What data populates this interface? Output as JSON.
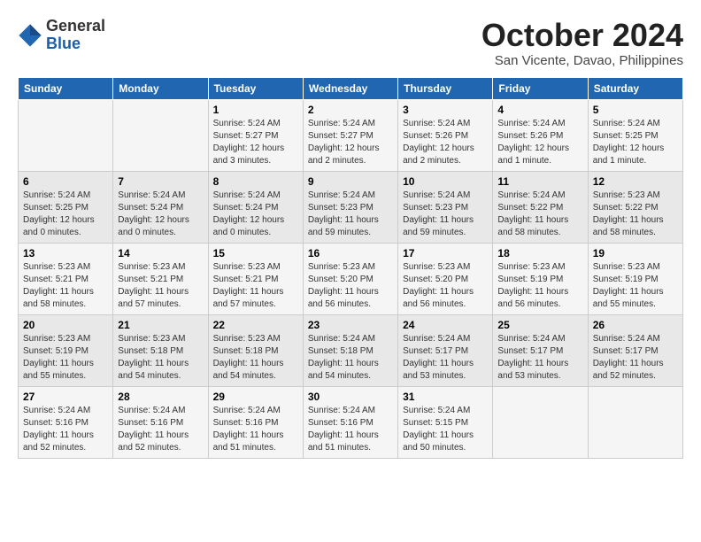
{
  "header": {
    "logo_general": "General",
    "logo_blue": "Blue",
    "month": "October 2024",
    "location": "San Vicente, Davao, Philippines"
  },
  "days_of_week": [
    "Sunday",
    "Monday",
    "Tuesday",
    "Wednesday",
    "Thursday",
    "Friday",
    "Saturday"
  ],
  "weeks": [
    [
      {
        "day": "",
        "info": ""
      },
      {
        "day": "",
        "info": ""
      },
      {
        "day": "1",
        "info": "Sunrise: 5:24 AM\nSunset: 5:27 PM\nDaylight: 12 hours and 3 minutes."
      },
      {
        "day": "2",
        "info": "Sunrise: 5:24 AM\nSunset: 5:27 PM\nDaylight: 12 hours and 2 minutes."
      },
      {
        "day": "3",
        "info": "Sunrise: 5:24 AM\nSunset: 5:26 PM\nDaylight: 12 hours and 2 minutes."
      },
      {
        "day": "4",
        "info": "Sunrise: 5:24 AM\nSunset: 5:26 PM\nDaylight: 12 hours and 1 minute."
      },
      {
        "day": "5",
        "info": "Sunrise: 5:24 AM\nSunset: 5:25 PM\nDaylight: 12 hours and 1 minute."
      }
    ],
    [
      {
        "day": "6",
        "info": "Sunrise: 5:24 AM\nSunset: 5:25 PM\nDaylight: 12 hours and 0 minutes."
      },
      {
        "day": "7",
        "info": "Sunrise: 5:24 AM\nSunset: 5:24 PM\nDaylight: 12 hours and 0 minutes."
      },
      {
        "day": "8",
        "info": "Sunrise: 5:24 AM\nSunset: 5:24 PM\nDaylight: 12 hours and 0 minutes."
      },
      {
        "day": "9",
        "info": "Sunrise: 5:24 AM\nSunset: 5:23 PM\nDaylight: 11 hours and 59 minutes."
      },
      {
        "day": "10",
        "info": "Sunrise: 5:24 AM\nSunset: 5:23 PM\nDaylight: 11 hours and 59 minutes."
      },
      {
        "day": "11",
        "info": "Sunrise: 5:24 AM\nSunset: 5:22 PM\nDaylight: 11 hours and 58 minutes."
      },
      {
        "day": "12",
        "info": "Sunrise: 5:23 AM\nSunset: 5:22 PM\nDaylight: 11 hours and 58 minutes."
      }
    ],
    [
      {
        "day": "13",
        "info": "Sunrise: 5:23 AM\nSunset: 5:21 PM\nDaylight: 11 hours and 58 minutes."
      },
      {
        "day": "14",
        "info": "Sunrise: 5:23 AM\nSunset: 5:21 PM\nDaylight: 11 hours and 57 minutes."
      },
      {
        "day": "15",
        "info": "Sunrise: 5:23 AM\nSunset: 5:21 PM\nDaylight: 11 hours and 57 minutes."
      },
      {
        "day": "16",
        "info": "Sunrise: 5:23 AM\nSunset: 5:20 PM\nDaylight: 11 hours and 56 minutes."
      },
      {
        "day": "17",
        "info": "Sunrise: 5:23 AM\nSunset: 5:20 PM\nDaylight: 11 hours and 56 minutes."
      },
      {
        "day": "18",
        "info": "Sunrise: 5:23 AM\nSunset: 5:19 PM\nDaylight: 11 hours and 56 minutes."
      },
      {
        "day": "19",
        "info": "Sunrise: 5:23 AM\nSunset: 5:19 PM\nDaylight: 11 hours and 55 minutes."
      }
    ],
    [
      {
        "day": "20",
        "info": "Sunrise: 5:23 AM\nSunset: 5:19 PM\nDaylight: 11 hours and 55 minutes."
      },
      {
        "day": "21",
        "info": "Sunrise: 5:23 AM\nSunset: 5:18 PM\nDaylight: 11 hours and 54 minutes."
      },
      {
        "day": "22",
        "info": "Sunrise: 5:23 AM\nSunset: 5:18 PM\nDaylight: 11 hours and 54 minutes."
      },
      {
        "day": "23",
        "info": "Sunrise: 5:24 AM\nSunset: 5:18 PM\nDaylight: 11 hours and 54 minutes."
      },
      {
        "day": "24",
        "info": "Sunrise: 5:24 AM\nSunset: 5:17 PM\nDaylight: 11 hours and 53 minutes."
      },
      {
        "day": "25",
        "info": "Sunrise: 5:24 AM\nSunset: 5:17 PM\nDaylight: 11 hours and 53 minutes."
      },
      {
        "day": "26",
        "info": "Sunrise: 5:24 AM\nSunset: 5:17 PM\nDaylight: 11 hours and 52 minutes."
      }
    ],
    [
      {
        "day": "27",
        "info": "Sunrise: 5:24 AM\nSunset: 5:16 PM\nDaylight: 11 hours and 52 minutes."
      },
      {
        "day": "28",
        "info": "Sunrise: 5:24 AM\nSunset: 5:16 PM\nDaylight: 11 hours and 52 minutes."
      },
      {
        "day": "29",
        "info": "Sunrise: 5:24 AM\nSunset: 5:16 PM\nDaylight: 11 hours and 51 minutes."
      },
      {
        "day": "30",
        "info": "Sunrise: 5:24 AM\nSunset: 5:16 PM\nDaylight: 11 hours and 51 minutes."
      },
      {
        "day": "31",
        "info": "Sunrise: 5:24 AM\nSunset: 5:15 PM\nDaylight: 11 hours and 50 minutes."
      },
      {
        "day": "",
        "info": ""
      },
      {
        "day": "",
        "info": ""
      }
    ]
  ]
}
